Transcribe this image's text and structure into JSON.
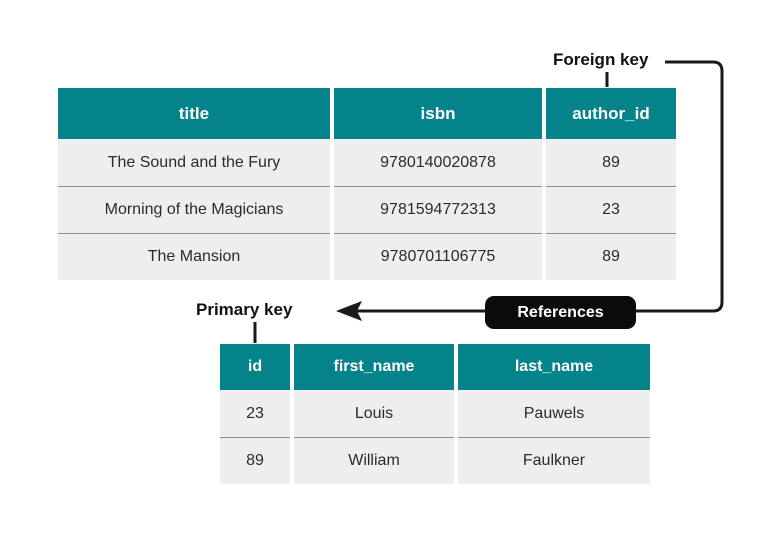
{
  "diagram": {
    "title": "Foreign key / primary key relationship diagram",
    "colors": {
      "header_teal": "#04838a",
      "row_gray": "#eeeeee",
      "row_separator": "#8c8c8c",
      "pill_black": "#0b0b0b",
      "connector_black": "#1a1a1a",
      "text_dark": "#2b2b2b",
      "background": "#ffffff"
    }
  },
  "annotations": {
    "foreign_key_label": "Foreign key",
    "primary_key_label": "Primary key",
    "references_badge": "References"
  },
  "tables": {
    "books": {
      "columns": [
        "title",
        "isbn",
        "author_id"
      ],
      "rows": [
        [
          "The Sound and the Fury",
          "9780140020878",
          "89"
        ],
        [
          "Morning of the Magicians",
          "9781594772313",
          "23"
        ],
        [
          "The Mansion",
          "9780701106775",
          "89"
        ]
      ]
    },
    "authors": {
      "columns": [
        "id",
        "first_name",
        "last_name"
      ],
      "rows": [
        [
          "23",
          "Louis",
          "Pauwels"
        ],
        [
          "89",
          "William",
          "Faulkner"
        ]
      ]
    }
  }
}
